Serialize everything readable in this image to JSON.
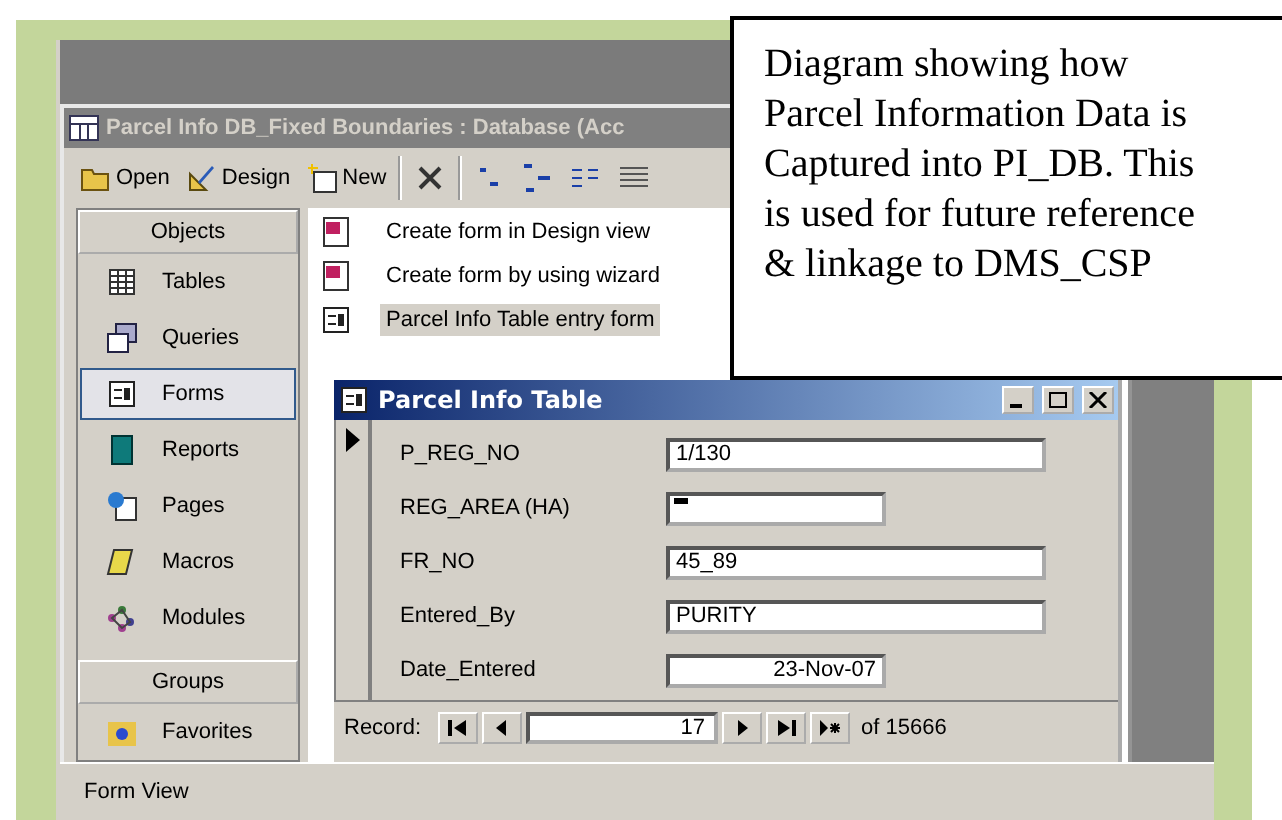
{
  "db_window": {
    "title": "Parcel Info DB_Fixed Boundaries : Database (Acc"
  },
  "toolbar": [
    {
      "kind": "open",
      "label": "Open"
    },
    {
      "kind": "design",
      "label": "Design"
    },
    {
      "kind": "new",
      "label": "New"
    },
    {
      "kind": "delete"
    },
    {
      "kind": "large-icons"
    },
    {
      "kind": "small-icons"
    },
    {
      "kind": "list"
    },
    {
      "kind": "details"
    }
  ],
  "objects": {
    "header": "Objects",
    "items": [
      {
        "kind": "tables",
        "label": "Tables",
        "selected": false
      },
      {
        "kind": "queries",
        "label": "Queries",
        "selected": false
      },
      {
        "kind": "forms",
        "label": "Forms",
        "selected": true
      },
      {
        "kind": "reports",
        "label": "Reports",
        "selected": false
      },
      {
        "kind": "pages",
        "label": "Pages",
        "selected": false
      },
      {
        "kind": "macros",
        "label": "Macros",
        "selected": false
      },
      {
        "kind": "modules",
        "label": "Modules",
        "selected": false
      }
    ]
  },
  "groups": {
    "header": "Groups",
    "items": [
      {
        "kind": "favorites",
        "label": "Favorites"
      }
    ]
  },
  "form_list": [
    {
      "kind": "shortcut",
      "label": "Create form in Design view",
      "selected": false
    },
    {
      "kind": "shortcut",
      "label": "Create form by using wizard",
      "selected": false
    },
    {
      "kind": "form",
      "label": "Parcel Info Table entry form",
      "selected": true
    }
  ],
  "form_window": {
    "title": "Parcel Info Table",
    "fields": [
      {
        "label": "P_REG_NO",
        "kind": "text",
        "value": "1/130"
      },
      {
        "label": "REG_AREA (HA)",
        "kind": "number"
      },
      {
        "label": "FR_NO",
        "kind": "text",
        "value": "45_89"
      },
      {
        "label": "Entered_By",
        "kind": "text",
        "value": "PURITY"
      },
      {
        "label": "Date_Entered",
        "kind": "date",
        "value": "23-Nov-07"
      }
    ],
    "navigation": {
      "label": "Record:",
      "current": "17",
      "total": "of 15666"
    }
  },
  "status_bar": "Form View",
  "callout": "Diagram showing how Parcel Information Data is Captured into PI_DB. This is used for future reference & linkage to DMS_CSP"
}
